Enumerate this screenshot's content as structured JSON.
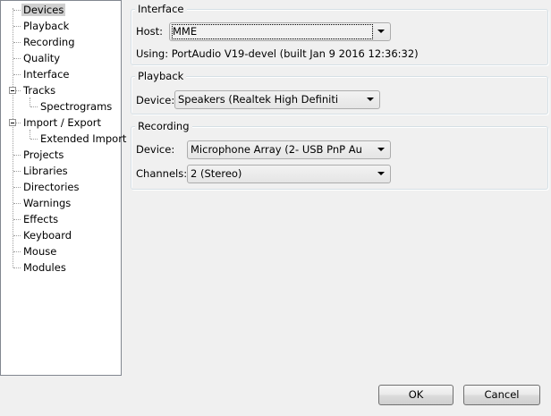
{
  "tree": {
    "items": [
      {
        "label": "Devices",
        "selected": true
      },
      {
        "label": "Playback"
      },
      {
        "label": "Recording"
      },
      {
        "label": "Quality"
      },
      {
        "label": "Interface"
      },
      {
        "label": "Tracks",
        "expanded": true
      },
      {
        "label": "Spectrograms",
        "child": true
      },
      {
        "label": "Import / Export",
        "expanded": true
      },
      {
        "label": "Extended Import",
        "child": true
      },
      {
        "label": "Projects"
      },
      {
        "label": "Libraries"
      },
      {
        "label": "Directories"
      },
      {
        "label": "Warnings"
      },
      {
        "label": "Effects"
      },
      {
        "label": "Keyboard"
      },
      {
        "label": "Mouse"
      },
      {
        "label": "Modules"
      }
    ]
  },
  "interface": {
    "title": "Interface",
    "host_label": "Host:",
    "host_value": "MME",
    "using_text": "Using: PortAudio V19-devel (built Jan  9 2016 12:36:32)"
  },
  "playback": {
    "title": "Playback",
    "device_label": "Device:",
    "device_value": "Speakers (Realtek High Definiti"
  },
  "recording": {
    "title": "Recording",
    "device_label": "Device:",
    "device_value": "Microphone Array (2- USB PnP Au",
    "channels_label": "Channels:",
    "channels_value": "2 (Stereo)"
  },
  "buttons": {
    "ok": "OK",
    "cancel": "Cancel"
  }
}
